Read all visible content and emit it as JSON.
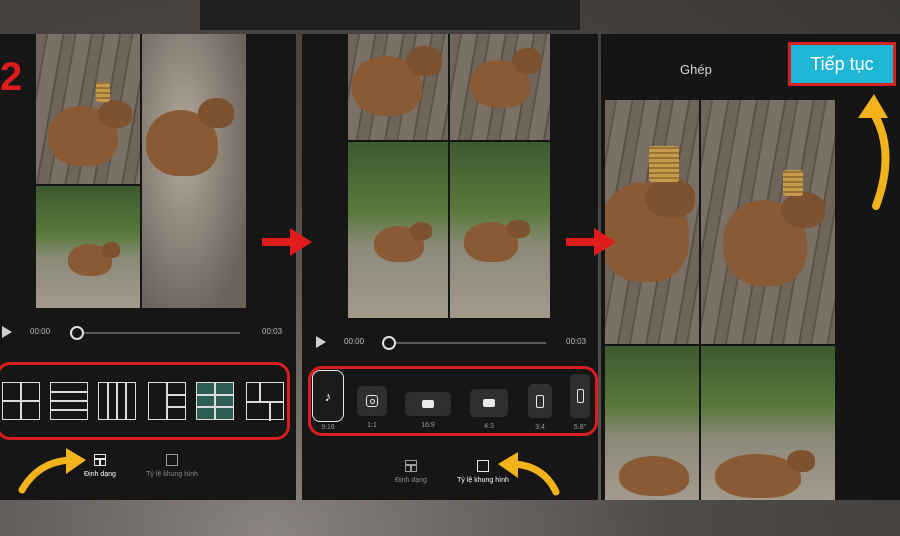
{
  "step_number": "2",
  "panel1": {
    "time_start": "00:00",
    "time_end": "00:03",
    "progress": 0.0,
    "layouts": [
      "grid-2x2",
      "rows-4",
      "cols-4",
      "split-left-rows",
      "mixed-selected",
      "mixed-alt"
    ],
    "tabs": [
      {
        "label": "Định dạng",
        "icon": "layout-icon",
        "active": true
      },
      {
        "label": "Tỷ lệ khung hình",
        "icon": "square-icon",
        "active": false
      }
    ]
  },
  "panel2": {
    "time_start": "00:00",
    "time_end": "00:03",
    "progress": 0.0,
    "ratios": [
      {
        "label": "9:16",
        "icon": "tiktok-icon"
      },
      {
        "label": "1:1",
        "icon": "instagram-icon"
      },
      {
        "label": "16:9",
        "icon": "youtube-icon"
      },
      {
        "label": "4:3",
        "icon": "youtube-icon"
      },
      {
        "label": "3:4",
        "icon": "phone-icon"
      },
      {
        "label": "5.8\"",
        "icon": "phone-icon"
      }
    ],
    "tabs": [
      {
        "label": "Định dạng",
        "icon": "layout-icon",
        "active": false
      },
      {
        "label": "Tỷ lệ khung hình",
        "icon": "square-icon",
        "active": true
      }
    ]
  },
  "panel3": {
    "title": "Ghép",
    "continue_button": "Tiếp tục"
  },
  "colors": {
    "highlight_red": "#d81e1e",
    "annotation_yellow": "#f2b21c",
    "cta_cyan": "#1fb6d6",
    "selected_layout": "#2e5e53"
  }
}
